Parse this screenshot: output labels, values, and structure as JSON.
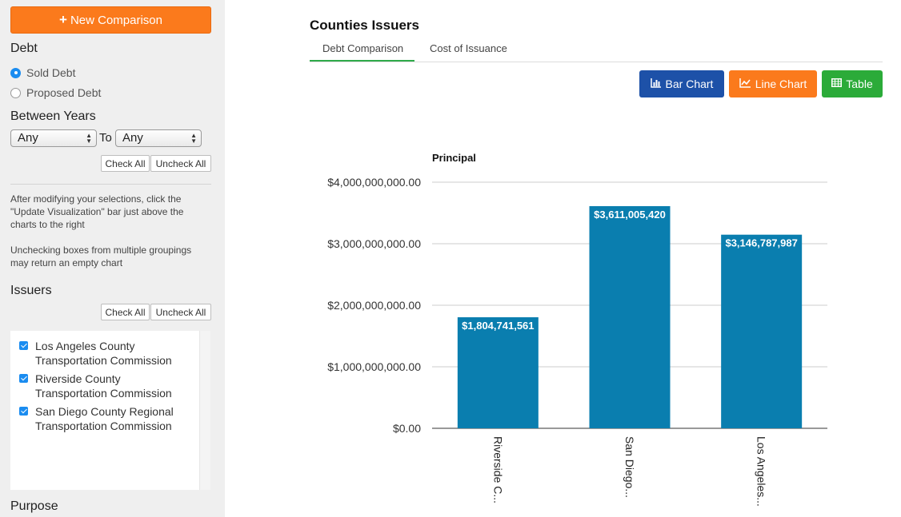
{
  "sidebar": {
    "new_button": "New Comparison",
    "debt_title": "Debt",
    "debt_options": [
      {
        "label": "Sold Debt",
        "selected": true
      },
      {
        "label": "Proposed Debt",
        "selected": false
      }
    ],
    "years_title": "Between Years",
    "year_from": "Any",
    "to_label": "To",
    "year_to": "Any",
    "check_all": "Check All",
    "uncheck_all": "Uncheck All",
    "note1": "After modifying your selections, click the \"Update Visualization\" bar just above the charts to the right",
    "note2": "Unchecking boxes from multiple groupings may return an empty chart",
    "issuers_title": "Issuers",
    "issuers": [
      {
        "label": "Los Angeles County Transportation Commission",
        "checked": true
      },
      {
        "label": "Riverside County Transportation Commission",
        "checked": true
      },
      {
        "label": "San Diego County Regional Transportation Commission",
        "checked": true
      }
    ],
    "purpose_title": "Purpose"
  },
  "main": {
    "title": "Counties Issuers",
    "tabs": [
      "Debt Comparison",
      "Cost of Issuance"
    ],
    "active_tab": "Debt Comparison",
    "view_buttons": [
      {
        "label": "Bar Chart",
        "icon": "bar-chart-icon",
        "color": "#1d51a8"
      },
      {
        "label": "Line Chart",
        "icon": "line-chart-icon",
        "color": "#fb7a1c"
      },
      {
        "label": "Table",
        "icon": "table-icon",
        "color": "#2bab39"
      }
    ]
  },
  "colors": {
    "bar": "#0a7eaf",
    "accent_orange": "#fb7a1c",
    "tab_underline": "#2eaa4a"
  },
  "chart_data": {
    "type": "bar",
    "title": "Principal",
    "categories": [
      "Riverside C...",
      "San Diego...",
      "Los Angeles..."
    ],
    "values": [
      1804741561,
      3611005420,
      3146787987
    ],
    "data_labels": [
      "$1,804,741,561",
      "$3,611,005,420",
      "$3,146,787,987"
    ],
    "y_ticks": [
      0,
      1000000000,
      2000000000,
      3000000000,
      4000000000
    ],
    "y_tick_labels": [
      "$0.00",
      "$1,000,000,000.00",
      "$2,000,000,000.00",
      "$3,000,000,000.00",
      "$4,000,000,000.00"
    ],
    "ylim": [
      0,
      4000000000
    ],
    "grid": true,
    "legend": "none"
  }
}
